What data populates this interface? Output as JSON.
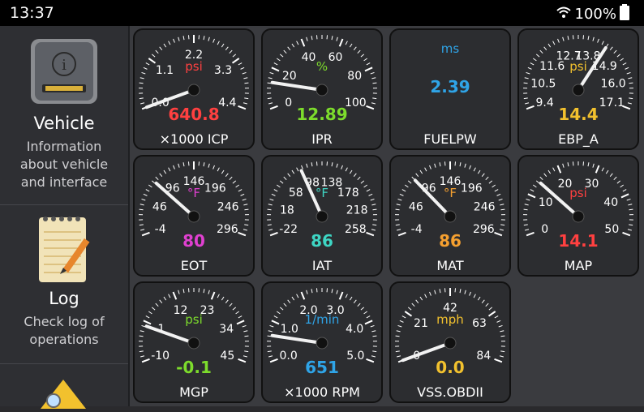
{
  "status": {
    "time": "13:37",
    "battery": "100%"
  },
  "sidebar": {
    "items": [
      {
        "title": "Vehicle",
        "desc": [
          "Information",
          "about vehicle",
          "and interface"
        ]
      },
      {
        "title": "Log",
        "desc": [
          "Check log of",
          "operations"
        ]
      }
    ]
  },
  "gauges": [
    {
      "name": "×1000 ICP",
      "unit": "psi",
      "unit_color": "#ff4040",
      "value": "640.8",
      "value_color": "#ff4040",
      "ticks": [
        "0.0",
        "1.1",
        "2.2",
        "3.3",
        "4.4"
      ],
      "needle_fraction": 0.0
    },
    {
      "name": "IPR",
      "unit": "%",
      "unit_color": "#7ddc2c",
      "value": "12.89",
      "value_color": "#7ddc2c",
      "ticks": [
        "0",
        "20",
        "40",
        "60",
        "80",
        "100"
      ],
      "needle_fraction": 0.13
    },
    {
      "name": "FUELPW",
      "unit": "ms",
      "unit_color": "#2fa4e7",
      "value": "2.39",
      "value_color": "#2fa4e7",
      "ticks": [],
      "needle_fraction": null
    },
    {
      "name": "EBP_A",
      "unit": "psi",
      "unit_color": "#f2c12e",
      "value": "14.4",
      "value_color": "#f2c12e",
      "ticks": [
        "9.4",
        "10.5",
        "11.6",
        "12.7",
        "13.8",
        "14.9",
        "16.0",
        "17.1"
      ],
      "needle_fraction": 0.65
    },
    {
      "name": "EOT",
      "unit": "°F",
      "unit_color": "#e040d0",
      "value": "80",
      "value_color": "#e040d0",
      "ticks": [
        "-4",
        "46",
        "96",
        "146",
        "196",
        "246",
        "296"
      ],
      "needle_fraction": 0.28
    },
    {
      "name": "IAT",
      "unit": "°F",
      "unit_color": "#3ed6c4",
      "value": "86",
      "value_color": "#3ed6c4",
      "ticks": [
        "-22",
        "18",
        "58",
        "98",
        "138",
        "178",
        "218",
        "258"
      ],
      "needle_fraction": 0.39
    },
    {
      "name": "MAT",
      "unit": "°F",
      "unit_color": "#f5a030",
      "value": "86",
      "value_color": "#f5a030",
      "ticks": [
        "-4",
        "46",
        "96",
        "146",
        "196",
        "246",
        "296"
      ],
      "needle_fraction": 0.3
    },
    {
      "name": "MAP",
      "unit": "psi",
      "unit_color": "#ff4040",
      "value": "14.1",
      "value_color": "#ff4040",
      "ticks": [
        "0",
        "10",
        "20",
        "30",
        "40",
        "50"
      ],
      "needle_fraction": 0.28
    },
    {
      "name": "MGP",
      "unit": "psi",
      "unit_color": "#7ddc2c",
      "value": "-0.1",
      "value_color": "#7ddc2c",
      "ticks": [
        "-10",
        "1",
        "12",
        "23",
        "34",
        "45"
      ],
      "needle_fraction": 0.18
    },
    {
      "name": "×1000 RPM",
      "unit": "1/min",
      "unit_color": "#2fa4e7",
      "value": "651",
      "value_color": "#2fa4e7",
      "ticks": [
        "0.0",
        "1.0",
        "2.0",
        "3.0",
        "4.0",
        "5.0"
      ],
      "needle_fraction": 0.13
    },
    {
      "name": "VSS.OBDII",
      "unit": "mph",
      "unit_color": "#f2c12e",
      "value": "0.0",
      "value_color": "#f2c12e",
      "ticks": [
        "0",
        "21",
        "42",
        "63",
        "84"
      ],
      "needle_fraction": 0.0
    }
  ]
}
